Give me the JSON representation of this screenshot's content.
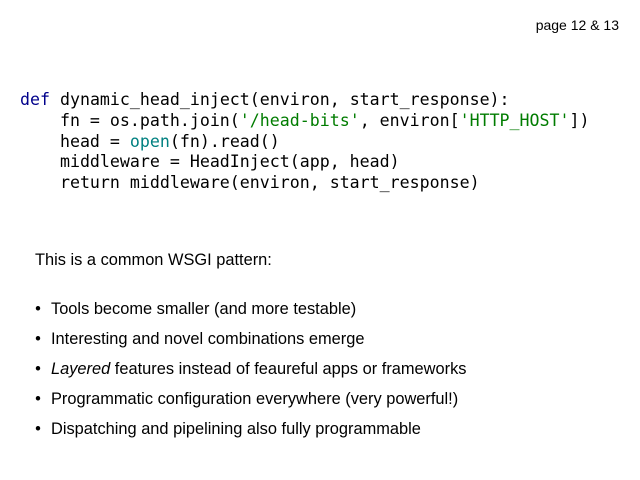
{
  "header": {
    "page_label": "page 12 & 13"
  },
  "code": {
    "lines": [
      [
        {
          "text": "def",
          "kind": "kw"
        },
        {
          "text": " dynamic_head_inject(environ, start_response):",
          "kind": "plain"
        }
      ],
      [
        {
          "text": "    fn = os.path.join(",
          "kind": "plain"
        },
        {
          "text": "'/head-bits'",
          "kind": "str"
        },
        {
          "text": ", environ[",
          "kind": "plain"
        },
        {
          "text": "'HTTP_HOST'",
          "kind": "str"
        },
        {
          "text": "])",
          "kind": "plain"
        }
      ],
      [
        {
          "text": "    head = ",
          "kind": "plain"
        },
        {
          "text": "open",
          "kind": "bi"
        },
        {
          "text": "(fn).read()",
          "kind": "plain"
        }
      ],
      [
        {
          "text": "    middleware = HeadInject(app, head)",
          "kind": "plain"
        }
      ],
      [
        {
          "text": "    return middleware(environ, start_response)",
          "kind": "plain"
        }
      ]
    ]
  },
  "body": {
    "intro": "This is a common WSGI pattern:",
    "bullet_symbol": "•",
    "bullets": [
      {
        "prefix": "",
        "emphasis": "",
        "rest": "Tools become smaller (and more testable)"
      },
      {
        "prefix": "",
        "emphasis": "",
        "rest": "Interesting and novel combinations emerge"
      },
      {
        "prefix": "",
        "emphasis": "Layered",
        "rest": " features instead of feaureful apps or frameworks"
      },
      {
        "prefix": "",
        "emphasis": "",
        "rest": "Programmatic configuration everywhere (very powerful!)"
      },
      {
        "prefix": "",
        "emphasis": "",
        "rest": "Dispatching and pipelining also fully programmable"
      }
    ]
  },
  "colors": {
    "background": "#ffffff",
    "text": "#000000",
    "keyword": "#00008b",
    "string": "#007c00",
    "builtin": "#008080"
  }
}
